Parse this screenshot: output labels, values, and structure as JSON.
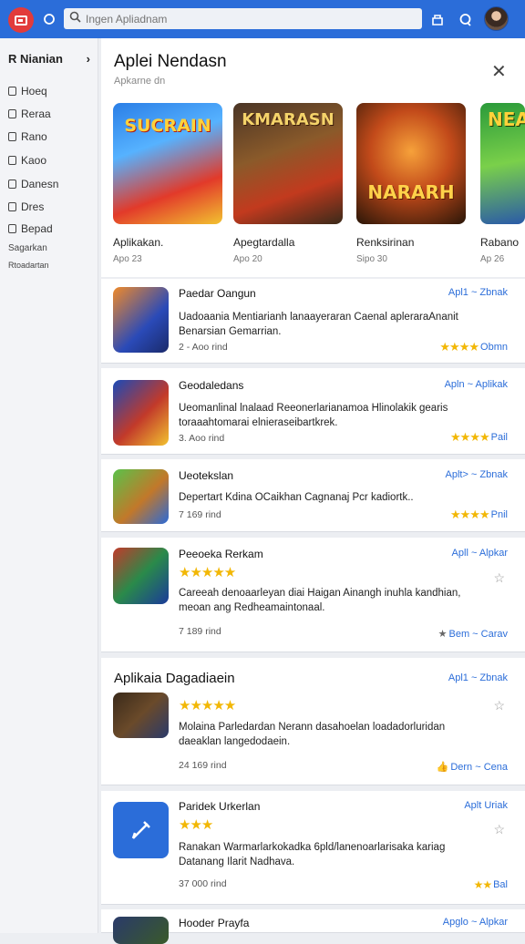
{
  "topbar": {
    "search_placeholder": "Ingen Apliadnam",
    "icons": [
      "logo-icon",
      "refresh-icon",
      "search-icon",
      "shop-icon",
      "chat-icon"
    ]
  },
  "sidebar": {
    "heading": "R Nianian",
    "items": [
      {
        "label": "Hoeq",
        "icon": "home-icon"
      },
      {
        "label": "Reraa",
        "icon": "person-icon"
      },
      {
        "label": "Rano",
        "icon": "book-icon"
      },
      {
        "label": "Kaoo",
        "icon": "user-icon"
      },
      {
        "label": "Danesn",
        "icon": "account-icon"
      },
      {
        "label": "Dres",
        "icon": "doc-icon"
      },
      {
        "label": "Bepad",
        "icon": "calendar-icon"
      }
    ],
    "footer1": "Sagarkan",
    "footer2": "Rtoadartan"
  },
  "panel": {
    "title": "Aplei Nendasn",
    "subtitle": "Apkarne dn",
    "featured": [
      {
        "art_text": "SUCRAIN",
        "name": "Aplikakan.",
        "meta": "Apo 23"
      },
      {
        "art_text": "KMARASN",
        "name": "Apegtardalla",
        "meta": "Apo 20"
      },
      {
        "art_text": "NARARH",
        "name": "Renksirinan",
        "meta": "Sipo 30"
      },
      {
        "art_text": "NEA",
        "name": "Rabano",
        "meta": "Ap 26"
      }
    ]
  },
  "cards": [
    {
      "title": "Paedar Oangun",
      "link": "Apl1 ~ Zbnak",
      "desc": "Uadoaania Mentiarianh lanaayeraran Caenal apleraraAnanit Benarsian Gemarrian.",
      "count": "2 - Aoo rind",
      "rating": "Obmn",
      "stars": "★★★★"
    },
    {
      "title": "Geodaledans",
      "link": "Apln ~ Aplikak",
      "desc": "Ueomanlinal lnalaad Reeonerlarianamoa Hlinolakik gearis toraaahtomarai elnieraseibartkrek.",
      "count": "3. Aoo rind",
      "rating": "Pail",
      "stars": "★★★★"
    },
    {
      "title": "Ueotekslan",
      "link": "Aplt> ~ Zbnak",
      "desc": "Depertart Kdina OCaikhan Cagnanaj Pcr kadiortk..",
      "count": "7 169 rind",
      "rating": "Pnil",
      "stars": "★★★★"
    },
    {
      "title": "Peeoeka Rerkam",
      "link": "Apll ~ Alpkar",
      "desc": "Careeah denoaarleyan diai Haigan Ainangh inuhla kandhian, meoan ang Redheamaintonaal.",
      "count": "7 189 rind",
      "rating": "Bem ~ Carav",
      "stars": "★★★★★"
    }
  ],
  "section": {
    "title": "Aplikaia Dagadiaein",
    "cards": [
      {
        "title": "",
        "link": "Apl1 ~ Zbnak",
        "desc": "Molaina Parledardan Nerann dasahoelan loadadorluridan daeaklan langedodaein.",
        "count": "24 169 rind",
        "rating": "Dern ~ Cena",
        "stars": "★★★★★"
      },
      {
        "title": "Paridek Urkerlan",
        "link": "Aplt Uriak",
        "desc": "Ranakan Warmarlarkokadka 6pld/lanenoarlarisaka kariag Datanang Ilarit Nadhava.",
        "count": "37 000 rind",
        "rating": "Bal",
        "stars": "★★★"
      },
      {
        "title": "Hooder Prayfa",
        "link": "Apglo ~ Alpkar",
        "desc": "",
        "count": "",
        "rating": "",
        "stars": ""
      }
    ]
  },
  "colors": {
    "accent": "#2b6dd9",
    "star": "#f2b705",
    "logo": "#e23b3b"
  }
}
